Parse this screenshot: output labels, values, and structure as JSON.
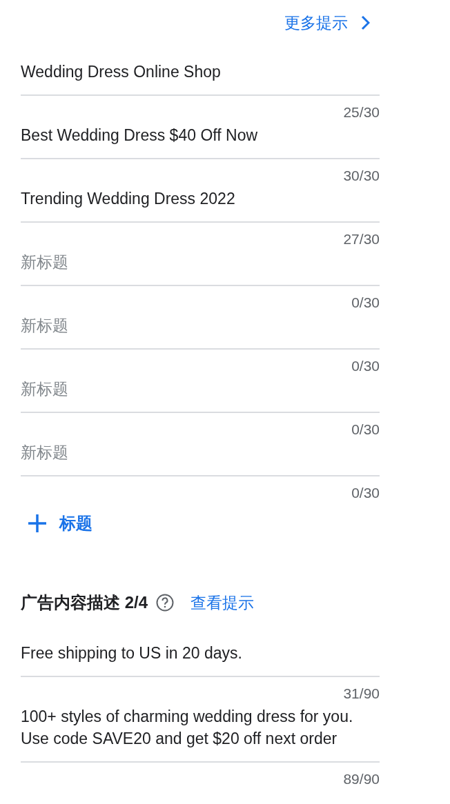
{
  "top_link": {
    "label": "更多提示"
  },
  "headlines": [
    {
      "value": "Wedding Dress Online Shop",
      "counter": "25/30"
    },
    {
      "value": "Best Wedding Dress $40 Off Now",
      "counter": "30/30"
    },
    {
      "value": "Trending Wedding Dress 2022",
      "counter": "27/30"
    },
    {
      "placeholder": "新标题",
      "counter": "0/30"
    },
    {
      "placeholder": "新标题",
      "counter": "0/30"
    },
    {
      "placeholder": "新标题",
      "counter": "0/30"
    },
    {
      "placeholder": "新标题",
      "counter": "0/30"
    }
  ],
  "add_button": {
    "label": "标题"
  },
  "descriptions": {
    "title": "广告内容描述 2/4",
    "hint_link": "查看提示",
    "fields": [
      {
        "value": "Free shipping to US in 20 days.",
        "counter": "31/90"
      },
      {
        "value": "100+ styles of charming wedding dress for you. Use code SAVE20 and get $20 off next order",
        "counter": "89/90"
      }
    ]
  }
}
